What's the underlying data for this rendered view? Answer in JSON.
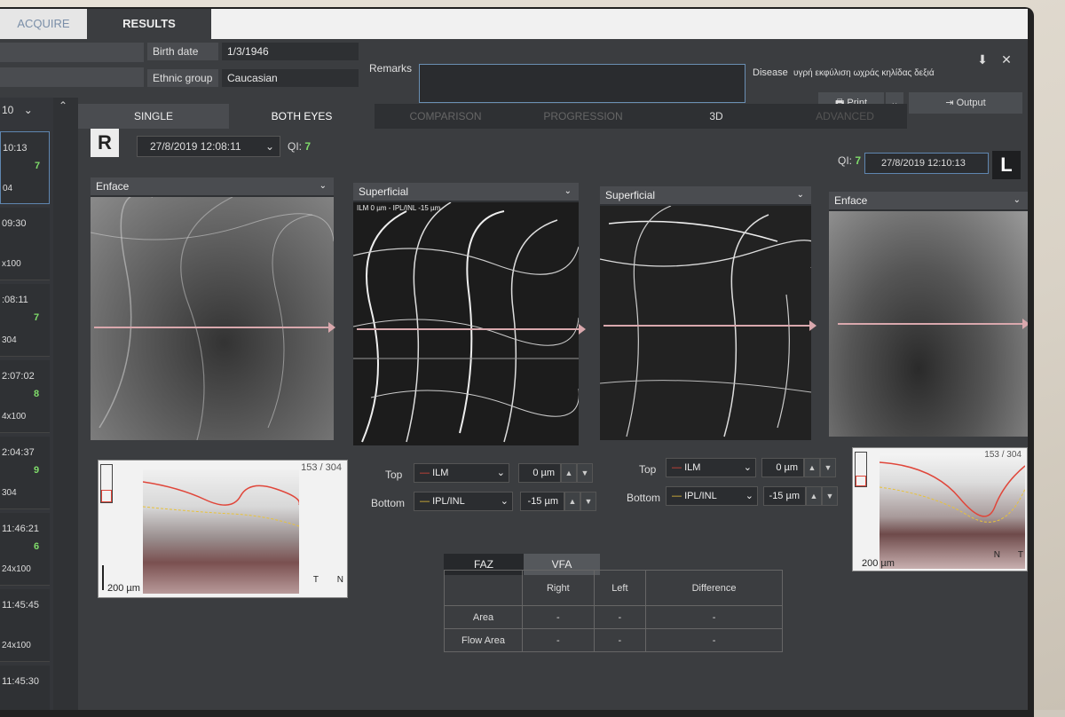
{
  "top_tabs": {
    "acquire": "ACQUIRE",
    "results": "RESULTS"
  },
  "patient": {
    "birth_label": "Birth date",
    "birth_value": "1/3/1946",
    "ethnic_label": "Ethnic group",
    "ethnic_value": "Caucasian",
    "remarks_label": "Remarks",
    "disease_label": "Disease",
    "disease_value": "υγρή εκφύλιση ωχράς κηλίδας δεξιά"
  },
  "toolbar": {
    "print": "Print",
    "output": "Output",
    "pin": "⬇",
    "close": "✕"
  },
  "sidebar": {
    "header": "10",
    "items": [
      {
        "time": "10:13",
        "qi": "7",
        "size": "04"
      },
      {
        "time": "09:30",
        "qi": "",
        "size": "x100"
      },
      {
        "time": ":08:11",
        "qi": "7",
        "size": "304"
      },
      {
        "time": "2:07:02",
        "qi": "8",
        "size": "4x100"
      },
      {
        "time": "2:04:37",
        "qi": "9",
        "size": "304"
      },
      {
        "time": "11:46:21",
        "qi": "6",
        "size": "24x100"
      },
      {
        "time": "11:45:45",
        "qi": "",
        "size": "24x100"
      },
      {
        "time": "11:45:30",
        "qi": "",
        "size": ""
      }
    ]
  },
  "view_tabs": {
    "single": "SINGLE",
    "both": "BOTH EYES",
    "comparison": "COMPARISON",
    "progression": "PROGRESSION",
    "three_d": "3D",
    "advanced": "ADVANCED"
  },
  "right_eye": {
    "badge": "R",
    "date": "27/8/2019 12:08:11",
    "qi_label": "QI:",
    "qi": "7"
  },
  "left_eye": {
    "badge": "L",
    "date": "27/8/2019 12:10:13",
    "qi_label": "QI:",
    "qi": "7"
  },
  "panels": {
    "p1": "Enface",
    "p2": "Superficial",
    "p2_overlay": "ILM 0 µm - IPL/INL -15 µm",
    "p3": "Superficial",
    "p4": "Enface"
  },
  "bscan_left": {
    "counter": "153 / 304",
    "scale": "200 µm",
    "t": "T",
    "n": "N"
  },
  "bscan_right": {
    "counter": "153 / 304",
    "scale": "200 µm",
    "n": "N",
    "t": "T"
  },
  "seg_r": {
    "top_label": "Top",
    "top_layer": "ILM",
    "top_offset": "0 µm",
    "bottom_label": "Bottom",
    "bottom_layer": "IPL/INL",
    "bottom_offset": "-15 µm"
  },
  "seg_l": {
    "top_label": "Top",
    "top_layer": "ILM",
    "top_offset": "0 µm",
    "bottom_label": "Bottom",
    "bottom_layer": "IPL/INL",
    "bottom_offset": "-15 µm"
  },
  "metrics": {
    "tab_faz": "FAZ",
    "tab_vfa": "VFA",
    "cols": [
      "",
      "Right",
      "Left",
      "Difference"
    ],
    "rows": [
      {
        "label": "Area",
        "right": "-",
        "left": "-",
        "diff": "-"
      },
      {
        "label": "Flow Area",
        "right": "-",
        "left": "-",
        "diff": "-"
      }
    ]
  },
  "colors": {
    "ilm": "#e0463a",
    "ipl": "#e8c23a",
    "qi": "#7fdc6a",
    "accent": "#5f86b0"
  }
}
